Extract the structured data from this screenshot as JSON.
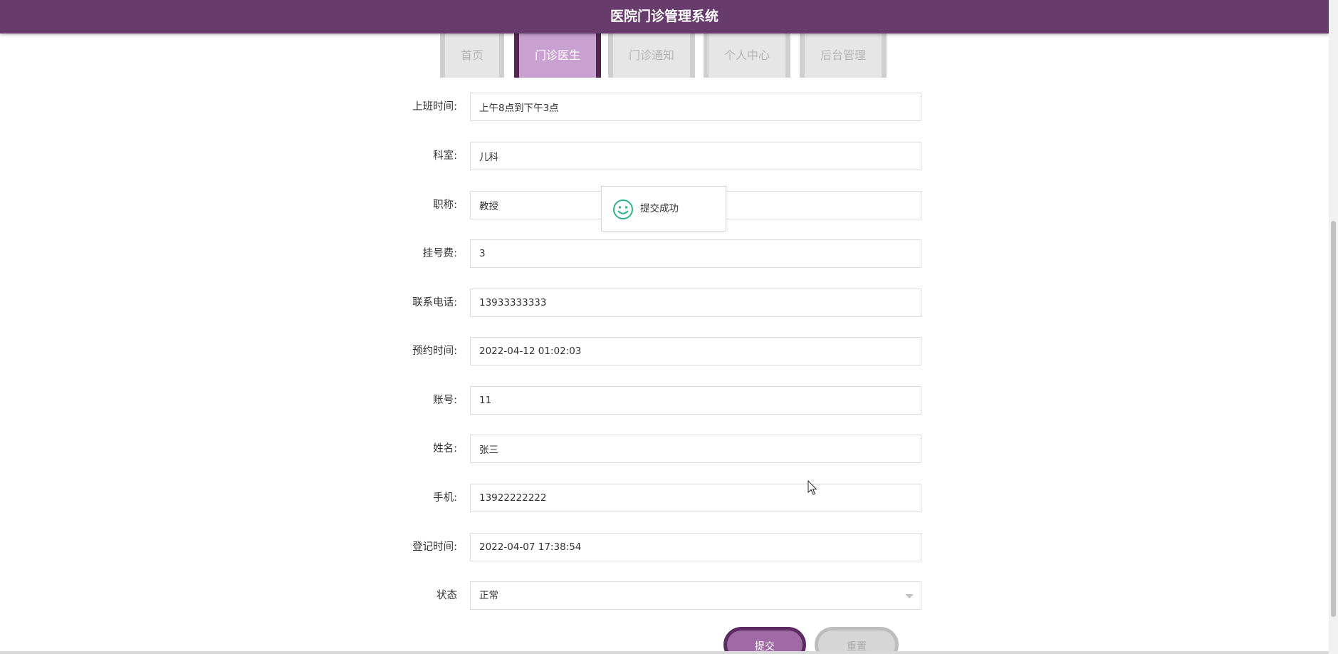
{
  "header": {
    "title": "医院门诊管理系统"
  },
  "nav": {
    "tabs": [
      {
        "label": "首页",
        "active": false
      },
      {
        "label": "门诊医生",
        "active": true
      },
      {
        "label": "门诊通知",
        "active": false
      },
      {
        "label": "个人中心",
        "active": false
      },
      {
        "label": "后台管理",
        "active": false
      }
    ]
  },
  "form": {
    "fields": [
      {
        "label": "上班时间:",
        "value": "上午8点到下午3点"
      },
      {
        "label": "科室:",
        "value": "儿科"
      },
      {
        "label": "职称:",
        "value": "教授"
      },
      {
        "label": "挂号费:",
        "value": "3"
      },
      {
        "label": "联系电话:",
        "value": "13933333333"
      },
      {
        "label": "预约时间:",
        "value": "2022-04-12 01:02:03"
      },
      {
        "label": "账号:",
        "value": "11"
      },
      {
        "label": "姓名:",
        "value": "张三"
      },
      {
        "label": "手机:",
        "value": "13922222222"
      },
      {
        "label": "登记时间:",
        "value": "2022-04-07 17:38:54"
      }
    ],
    "status": {
      "label": "状态",
      "value": "正常"
    },
    "submit_label": "提交",
    "reset_label": "重置"
  },
  "toast": {
    "icon": "smile-icon",
    "message": "提交成功"
  },
  "colors": {
    "header_bg": "#673b6b",
    "tab_active_bg": "#c9a1d1",
    "tab_active_border": "#52264f",
    "tab_inactive_bg": "#e6e6e6",
    "submit_bg": "#a06aa4",
    "toast_icon": "#2fb38b"
  }
}
